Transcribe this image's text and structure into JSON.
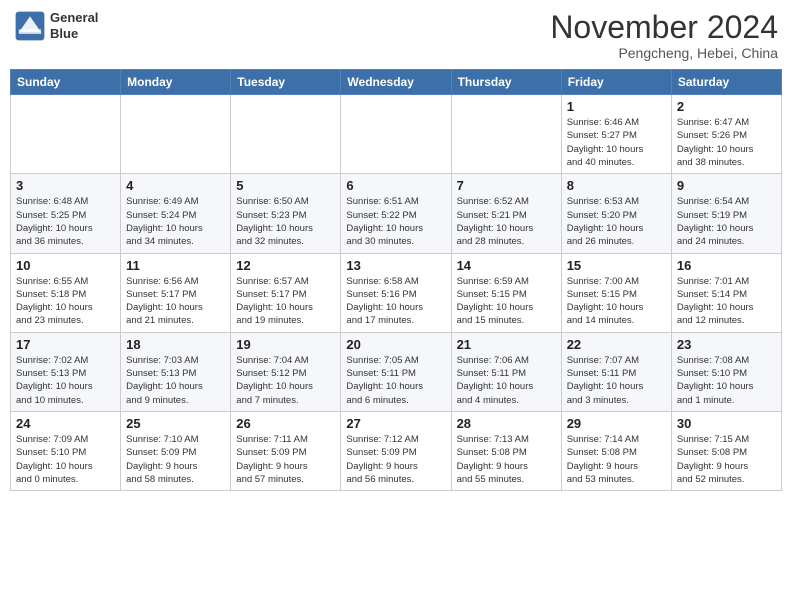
{
  "header": {
    "logo_line1": "General",
    "logo_line2": "Blue",
    "month": "November 2024",
    "location": "Pengcheng, Hebei, China"
  },
  "weekdays": [
    "Sunday",
    "Monday",
    "Tuesday",
    "Wednesday",
    "Thursday",
    "Friday",
    "Saturday"
  ],
  "weeks": [
    [
      {
        "day": null,
        "info": null
      },
      {
        "day": null,
        "info": null
      },
      {
        "day": null,
        "info": null
      },
      {
        "day": null,
        "info": null
      },
      {
        "day": null,
        "info": null
      },
      {
        "day": "1",
        "info": "Sunrise: 6:46 AM\nSunset: 5:27 PM\nDaylight: 10 hours\nand 40 minutes."
      },
      {
        "day": "2",
        "info": "Sunrise: 6:47 AM\nSunset: 5:26 PM\nDaylight: 10 hours\nand 38 minutes."
      }
    ],
    [
      {
        "day": "3",
        "info": "Sunrise: 6:48 AM\nSunset: 5:25 PM\nDaylight: 10 hours\nand 36 minutes."
      },
      {
        "day": "4",
        "info": "Sunrise: 6:49 AM\nSunset: 5:24 PM\nDaylight: 10 hours\nand 34 minutes."
      },
      {
        "day": "5",
        "info": "Sunrise: 6:50 AM\nSunset: 5:23 PM\nDaylight: 10 hours\nand 32 minutes."
      },
      {
        "day": "6",
        "info": "Sunrise: 6:51 AM\nSunset: 5:22 PM\nDaylight: 10 hours\nand 30 minutes."
      },
      {
        "day": "7",
        "info": "Sunrise: 6:52 AM\nSunset: 5:21 PM\nDaylight: 10 hours\nand 28 minutes."
      },
      {
        "day": "8",
        "info": "Sunrise: 6:53 AM\nSunset: 5:20 PM\nDaylight: 10 hours\nand 26 minutes."
      },
      {
        "day": "9",
        "info": "Sunrise: 6:54 AM\nSunset: 5:19 PM\nDaylight: 10 hours\nand 24 minutes."
      }
    ],
    [
      {
        "day": "10",
        "info": "Sunrise: 6:55 AM\nSunset: 5:18 PM\nDaylight: 10 hours\nand 23 minutes."
      },
      {
        "day": "11",
        "info": "Sunrise: 6:56 AM\nSunset: 5:17 PM\nDaylight: 10 hours\nand 21 minutes."
      },
      {
        "day": "12",
        "info": "Sunrise: 6:57 AM\nSunset: 5:17 PM\nDaylight: 10 hours\nand 19 minutes."
      },
      {
        "day": "13",
        "info": "Sunrise: 6:58 AM\nSunset: 5:16 PM\nDaylight: 10 hours\nand 17 minutes."
      },
      {
        "day": "14",
        "info": "Sunrise: 6:59 AM\nSunset: 5:15 PM\nDaylight: 10 hours\nand 15 minutes."
      },
      {
        "day": "15",
        "info": "Sunrise: 7:00 AM\nSunset: 5:15 PM\nDaylight: 10 hours\nand 14 minutes."
      },
      {
        "day": "16",
        "info": "Sunrise: 7:01 AM\nSunset: 5:14 PM\nDaylight: 10 hours\nand 12 minutes."
      }
    ],
    [
      {
        "day": "17",
        "info": "Sunrise: 7:02 AM\nSunset: 5:13 PM\nDaylight: 10 hours\nand 10 minutes."
      },
      {
        "day": "18",
        "info": "Sunrise: 7:03 AM\nSunset: 5:13 PM\nDaylight: 10 hours\nand 9 minutes."
      },
      {
        "day": "19",
        "info": "Sunrise: 7:04 AM\nSunset: 5:12 PM\nDaylight: 10 hours\nand 7 minutes."
      },
      {
        "day": "20",
        "info": "Sunrise: 7:05 AM\nSunset: 5:11 PM\nDaylight: 10 hours\nand 6 minutes."
      },
      {
        "day": "21",
        "info": "Sunrise: 7:06 AM\nSunset: 5:11 PM\nDaylight: 10 hours\nand 4 minutes."
      },
      {
        "day": "22",
        "info": "Sunrise: 7:07 AM\nSunset: 5:11 PM\nDaylight: 10 hours\nand 3 minutes."
      },
      {
        "day": "23",
        "info": "Sunrise: 7:08 AM\nSunset: 5:10 PM\nDaylight: 10 hours\nand 1 minute."
      }
    ],
    [
      {
        "day": "24",
        "info": "Sunrise: 7:09 AM\nSunset: 5:10 PM\nDaylight: 10 hours\nand 0 minutes."
      },
      {
        "day": "25",
        "info": "Sunrise: 7:10 AM\nSunset: 5:09 PM\nDaylight: 9 hours\nand 58 minutes."
      },
      {
        "day": "26",
        "info": "Sunrise: 7:11 AM\nSunset: 5:09 PM\nDaylight: 9 hours\nand 57 minutes."
      },
      {
        "day": "27",
        "info": "Sunrise: 7:12 AM\nSunset: 5:09 PM\nDaylight: 9 hours\nand 56 minutes."
      },
      {
        "day": "28",
        "info": "Sunrise: 7:13 AM\nSunset: 5:08 PM\nDaylight: 9 hours\nand 55 minutes."
      },
      {
        "day": "29",
        "info": "Sunrise: 7:14 AM\nSunset: 5:08 PM\nDaylight: 9 hours\nand 53 minutes."
      },
      {
        "day": "30",
        "info": "Sunrise: 7:15 AM\nSunset: 5:08 PM\nDaylight: 9 hours\nand 52 minutes."
      }
    ]
  ]
}
